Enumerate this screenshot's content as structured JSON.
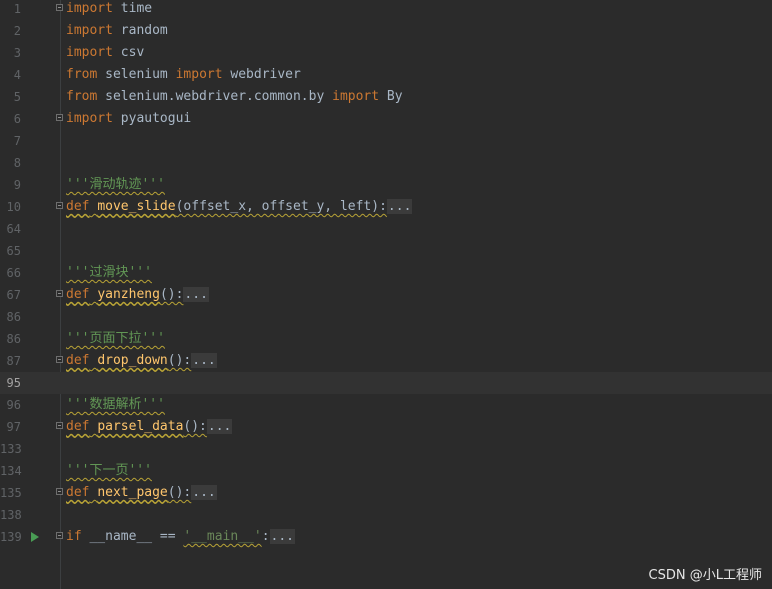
{
  "editor": {
    "lines": {
      "l1": {
        "num": "1",
        "kw": "import",
        "rest": " time"
      },
      "l2": {
        "num": "2",
        "kw": "import",
        "rest": " random"
      },
      "l3": {
        "num": "3",
        "kw": "import",
        "rest": " csv"
      },
      "l4": {
        "num": "4",
        "kw1": "from",
        "mid": " selenium ",
        "kw2": "import",
        "rest": " webdriver"
      },
      "l5": {
        "num": "5",
        "kw1": "from",
        "mid": " selenium.webdriver.common.by ",
        "kw2": "import",
        "rest": " By"
      },
      "l6": {
        "num": "6",
        "kw": "import",
        "rest": " pyautogui"
      },
      "l7": {
        "num": "7"
      },
      "l8": {
        "num": "8"
      },
      "l9": {
        "num": "9",
        "doc": "'''滑动轨迹'''"
      },
      "l10": {
        "num": "10",
        "kw": "def",
        "fn": "move_slide",
        "params": "(offset_x, offset_y, left):",
        "folded": "..."
      },
      "l64": {
        "num": "64"
      },
      "l65": {
        "num": "65"
      },
      "l66": {
        "num": "66",
        "doc": "'''过滑块'''"
      },
      "l67": {
        "num": "67",
        "kw": "def",
        "fn": "yanzheng",
        "params": "():",
        "folded": "..."
      },
      "l86": {
        "num": "86"
      },
      "l87doc": {
        "num": "86",
        "doc": "'''页面下拉'''"
      },
      "l87": {
        "num": "87",
        "kw": "def",
        "fn": "drop_down",
        "params": "():",
        "folded": "..."
      },
      "l95": {
        "num": "95"
      },
      "l96": {
        "num": "96",
        "doc": "'''数据解析'''"
      },
      "l97": {
        "num": "97",
        "kw": "def",
        "fn": "parsel_data",
        "params": "():",
        "folded": "..."
      },
      "l133": {
        "num": "133"
      },
      "l134": {
        "num": "134",
        "doc": "'''下一页'''"
      },
      "l135": {
        "num": "135",
        "kw": "def",
        "fn": "next_page",
        "params": "():",
        "folded": "..."
      },
      "l138": {
        "num": "138"
      },
      "l139": {
        "num": "139",
        "kw": "if",
        "mid": " __name__ == ",
        "str": "'__main__'",
        "colon": ":",
        "folded": "..."
      }
    }
  },
  "watermark": "CSDN @小L工程师",
  "colors": {
    "background": "#2b2b2b",
    "keyword": "#cc7832",
    "function": "#ffc66d",
    "docstring": "#629755",
    "string": "#6a8759",
    "text": "#a9b7c6",
    "run_icon": "#499c54"
  }
}
